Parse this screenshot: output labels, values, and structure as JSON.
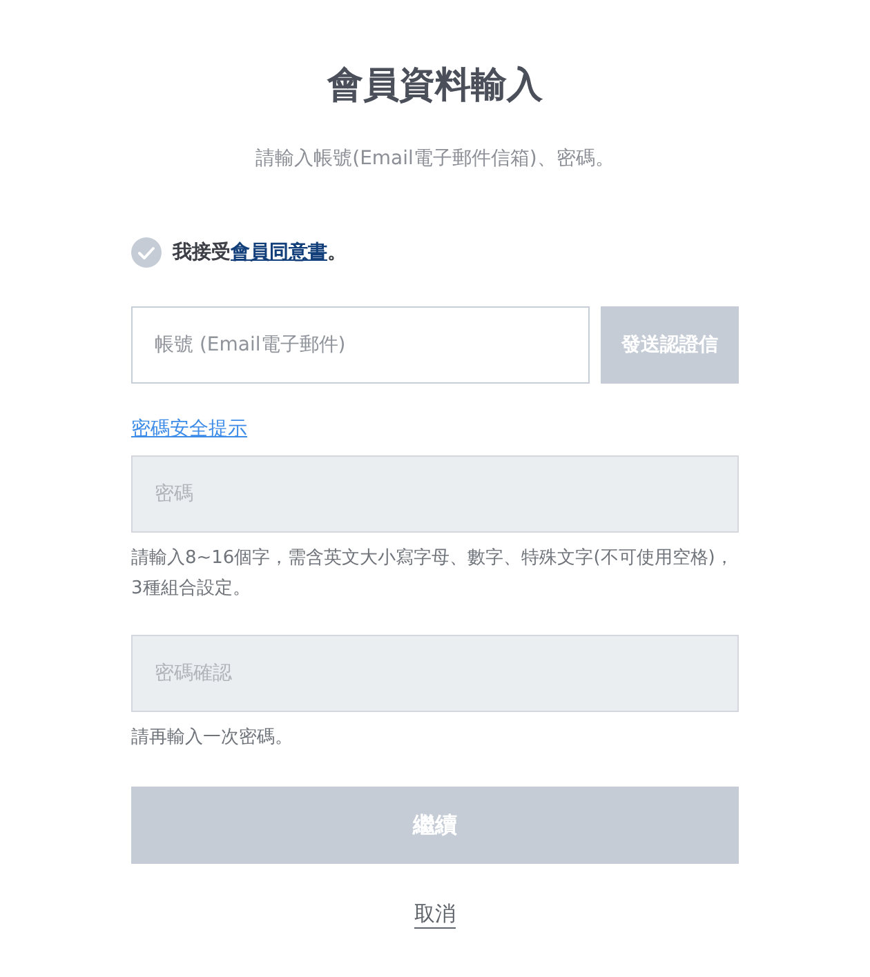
{
  "title": "會員資料輸入",
  "subtitle": "請輸入帳號(Email電子郵件信箱)、密碼。",
  "agreement": {
    "checked": false,
    "prefix": "我接受",
    "link": "會員同意書",
    "suffix": "。"
  },
  "email": {
    "placeholder": "帳號 (Email電子郵件)",
    "disabled": false,
    "button": {
      "label": "發送認證信",
      "disabled": true
    }
  },
  "password_tips_link": "密碼安全提示",
  "password": {
    "placeholder": "密碼",
    "disabled": true,
    "hint": "請輸入8~16個字，需含英文大小寫字母、數字、特殊文字(不可使用空格)，3種組合設定。"
  },
  "password_confirm": {
    "placeholder": "密碼確認",
    "disabled": true,
    "hint": "請再輸入一次密碼。"
  },
  "continue_button": {
    "label": "繼續",
    "disabled": true
  },
  "cancel_link": "取消"
}
